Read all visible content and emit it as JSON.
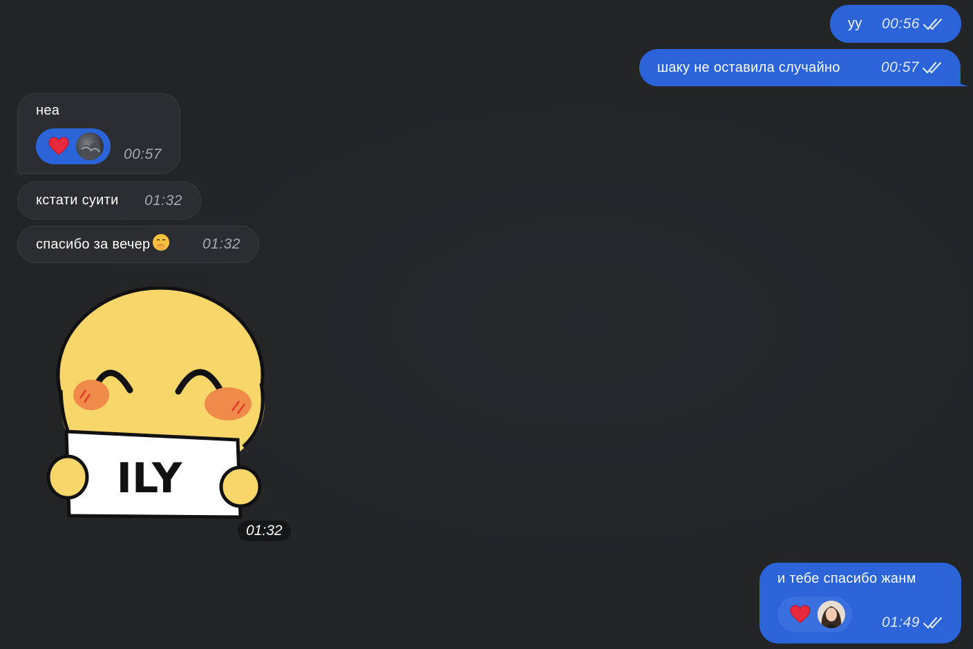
{
  "messages": [
    {
      "id": "m1",
      "direction": "outgoing",
      "text": "уу",
      "time": "00:56",
      "read": true
    },
    {
      "id": "m2",
      "direction": "outgoing",
      "text": "шаку не оставила случайно",
      "time": "00:57",
      "read": true
    },
    {
      "id": "m3",
      "direction": "incoming",
      "text": "неа",
      "time": "00:57",
      "reaction": {
        "emoji": "❤️",
        "avatar": "dark-gray-avatar"
      }
    },
    {
      "id": "m4",
      "direction": "incoming",
      "text": "кстати суити",
      "time": "01:32"
    },
    {
      "id": "m5",
      "direction": "incoming",
      "text": "спасибо за вечер",
      "emoji": "🤭",
      "time": "01:32"
    },
    {
      "id": "m6",
      "direction": "incoming",
      "type": "sticker",
      "sticker_text": "ILY",
      "time": "01:32"
    },
    {
      "id": "m7",
      "direction": "outgoing",
      "text": "и тебе спасибо жанм",
      "time": "01:49",
      "read": true,
      "reaction": {
        "emoji": "❤️",
        "avatar": "girl-portrait-avatar"
      }
    }
  ],
  "colors": {
    "background": "#232527",
    "outgoing_bubble": "#2b63d9",
    "incoming_bubble": "#2c2d30",
    "reaction_pill_incoming": "#2b63d9",
    "reaction_pill_outgoing": "#3a6fe0",
    "sticker_face": "#f8d66a",
    "sticker_blush": "#ef8a4a"
  }
}
